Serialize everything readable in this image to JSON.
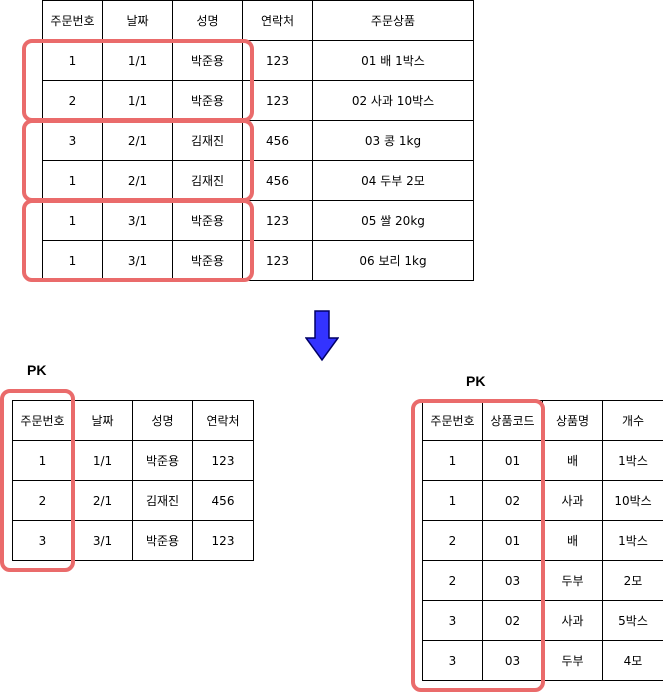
{
  "top_table": {
    "headers": [
      "주문번호",
      "날짜",
      "성명",
      "연락처",
      "주문상품"
    ],
    "rows": [
      [
        "1",
        "1/1",
        "박준용",
        "123",
        "01 배 1박스"
      ],
      [
        "2",
        "1/1",
        "박준용",
        "123",
        "02 사과 10박스"
      ],
      [
        "3",
        "2/1",
        "김재진",
        "456",
        "03 콩 1kg"
      ],
      [
        "1",
        "2/1",
        "김재진",
        "456",
        "04 두부 2모"
      ],
      [
        "1",
        "3/1",
        "박준용",
        "123",
        "05 쌀 20kg"
      ],
      [
        "1",
        "3/1",
        "박준용",
        "123",
        "06 보리 1kg"
      ]
    ]
  },
  "left_table": {
    "pk_label": "PK",
    "headers": [
      "주문번호",
      "날짜",
      "성명",
      "연락처"
    ],
    "rows": [
      [
        "1",
        "1/1",
        "박준용",
        "123"
      ],
      [
        "2",
        "2/1",
        "김재진",
        "456"
      ],
      [
        "3",
        "3/1",
        "박준용",
        "123"
      ]
    ]
  },
  "right_table": {
    "pk_label": "PK",
    "headers": [
      "주문번호",
      "상품코드",
      "상품명",
      "개수"
    ],
    "rows": [
      [
        "1",
        "01",
        "배",
        "1박스"
      ],
      [
        "1",
        "02",
        "사과",
        "10박스"
      ],
      [
        "2",
        "01",
        "배",
        "1박스"
      ],
      [
        "2",
        "03",
        "두부",
        "2모"
      ],
      [
        "3",
        "02",
        "사과",
        "5박스"
      ],
      [
        "3",
        "03",
        "두부",
        "4모"
      ]
    ]
  },
  "colors": {
    "highlight": "#ea6b6b",
    "arrow_fill": "#3333ff",
    "arrow_stroke": "#000066"
  }
}
